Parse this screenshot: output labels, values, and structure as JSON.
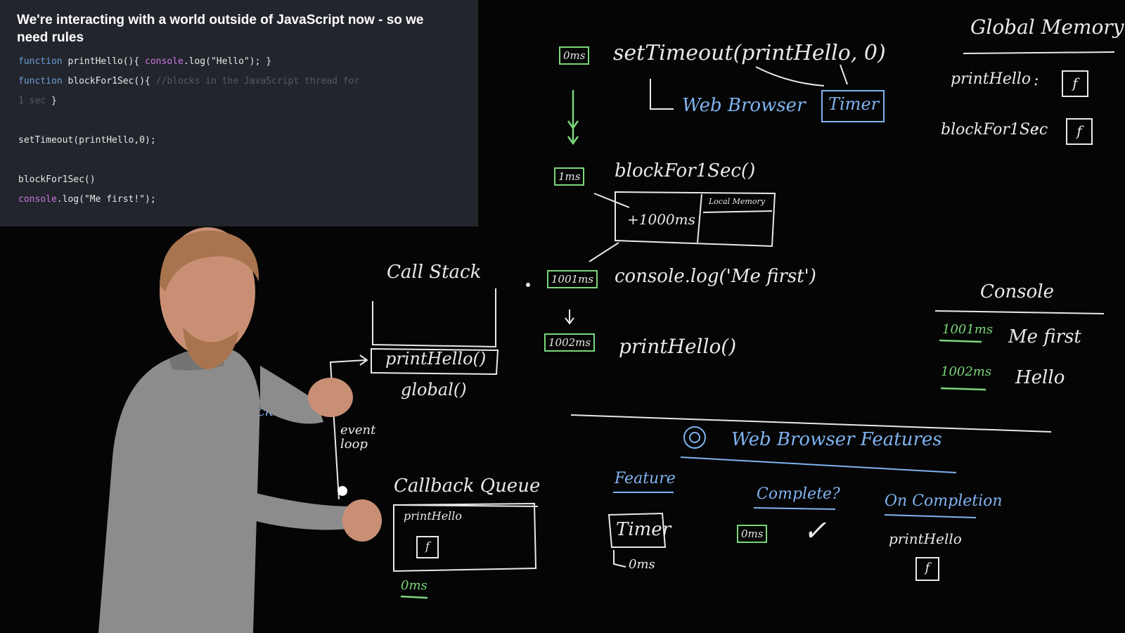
{
  "slide": {
    "title": "We're interacting with a world outside of JavaScript now - so we need rules",
    "code": {
      "line1": {
        "kw": "function",
        "rest": " printHello(){ ",
        "obj": "console",
        "call": ".log(\"Hello\"); }"
      },
      "line2": {
        "kw": "function",
        "rest": " blockFor1Sec(){ ",
        "comment": "//blocks in the JavaScript thread for"
      },
      "line3": {
        "comment": "1 sec",
        "rest": " }"
      },
      "line4": "setTimeout(printHello,0);",
      "line5": "blockFor1Sec()",
      "line6": {
        "obj": "console",
        "call": ".log(\"Me first!\");"
      }
    }
  },
  "board": {
    "global_memory": {
      "title": "Global Memory",
      "entries": [
        {
          "name": "printHello",
          "sep": ":",
          "value": "f"
        },
        {
          "name": "blockFor1Sec",
          "sep": ":",
          "value": "f"
        }
      ]
    },
    "timeline": [
      {
        "time": "0ms",
        "code": "setTimeout(printHello, 0)"
      },
      {
        "time": "1ms",
        "code": "blockFor1Sec()"
      },
      {
        "time": "1001ms",
        "code": "console.log('Me first')"
      },
      {
        "time": "1002ms",
        "code": "printHello()"
      }
    ],
    "web_browser_label": "Web   Browser",
    "timer_label": "Timer",
    "exec_context": {
      "local_memory": "Local Memory",
      "thread": "+1000ms"
    },
    "call_stack": {
      "title": "Call Stack",
      "frames": [
        "printHello()",
        "global()"
      ]
    },
    "event_loop": "event loop",
    "sockets": "Sockets",
    "callback_queue": {
      "title": "Callback Queue",
      "item": "printHello",
      "fn": "f",
      "time": "0ms"
    },
    "console": {
      "title": "Console",
      "rows": [
        {
          "time": "1001ms",
          "output": "Me first"
        },
        {
          "time": "1002ms",
          "output": "Hello"
        }
      ]
    },
    "features": {
      "title": "Web   Browser   Features",
      "headers": [
        "Feature",
        "Complete?",
        "On Completion"
      ],
      "feature": "Timer",
      "feature_time": "0ms",
      "complete_time": "0ms",
      "check": "✓",
      "on_completion": "printHello",
      "fn": "f"
    }
  },
  "colors": {
    "chalk_green": "#7bd67a",
    "chalk_blue": "#7fb3f0",
    "chalk_white": "#e9e9e9",
    "slide_bg": "#23252d"
  }
}
